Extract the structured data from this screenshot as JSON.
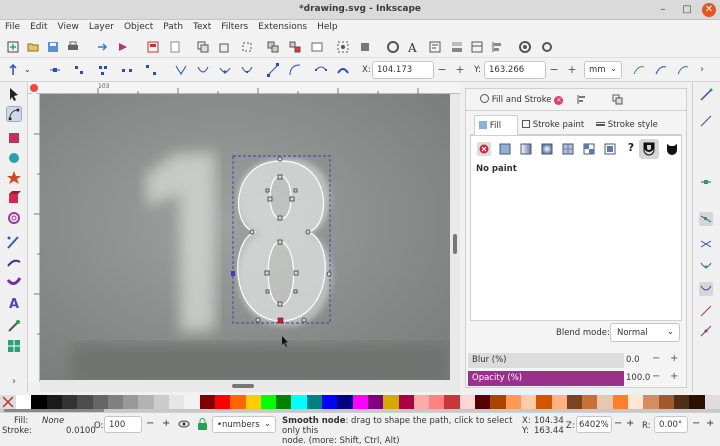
{
  "window": {
    "title": "*drawing.svg - Inkscape",
    "minimize": "–",
    "maximize": "□",
    "close": "✕"
  },
  "menu": [
    "File",
    "Edit",
    "View",
    "Layer",
    "Object",
    "Path",
    "Text",
    "Filters",
    "Extensions",
    "Help"
  ],
  "node_toolbar": {
    "x_label": "X:",
    "x_value": "104.173",
    "y_label": "Y:",
    "y_value": "163.266",
    "unit": "mm",
    "minus": "−",
    "plus": "+"
  },
  "ruler": {
    "tick_label": "103"
  },
  "fill_stroke": {
    "tab_title": "Fill and Stroke",
    "sub_tabs": [
      "Fill",
      "Stroke paint",
      "Stroke style"
    ],
    "fill_state": "No paint",
    "blend_mode_label": "Blend mode:",
    "blend_mode_value": "Normal",
    "blur_label": "Blur (%)",
    "blur_value": "0.0",
    "opacity_label": "Opacity (%)",
    "opacity_value": "100.0"
  },
  "status": {
    "fill_label": "Fill:",
    "fill_value": "None",
    "stroke_label": "Stroke:",
    "stroke_width": "0.0100",
    "opacity_label": "O:",
    "opacity_value": "100",
    "layer": "•numbers",
    "message_bold": "Smooth node",
    "message_rest": ": drag to shape the path, click to select only this",
    "message_line2": "node. (more: Shift, Ctrl, Alt)",
    "cursor_x_label": "X:",
    "cursor_x": "104.34",
    "cursor_y_label": "Y:",
    "cursor_y": "163.44",
    "zoom_label": "Z:",
    "zoom": "6402%",
    "rotation_label": "R:",
    "rotation": "0.00°"
  },
  "colors": {
    "selection": "#3b3bbf",
    "opacity_bar": "#9b2f8c",
    "active_node": "#d82020"
  },
  "palette": [
    "#ffffff",
    "#000000",
    "#1a1a1a",
    "#333333",
    "#4d4d4d",
    "#666666",
    "#808080",
    "#999999",
    "#b3b3b3",
    "#cccccc",
    "#e6e6e6",
    "#f2f2f2",
    "#800000",
    "#ff0000",
    "#ff6600",
    "#ffcc00",
    "#00ff00",
    "#008000",
    "#00ffff",
    "#008080",
    "#0000ff",
    "#000080",
    "#ff00ff",
    "#800080",
    "#d4aa00",
    "#aa0044",
    "#ffaaaa",
    "#ff8080",
    "#c83737",
    "#ffd5d5",
    "#550000",
    "#aa4400",
    "#ff9955",
    "#ffccaa",
    "#d45500",
    "#ffb380",
    "#784421",
    "#c87137",
    "#e9c6af",
    "#ff7f2a",
    "#ffe6d5",
    "#d38d5f",
    "#a05a2c",
    "#502d16",
    "#2b1100"
  ]
}
